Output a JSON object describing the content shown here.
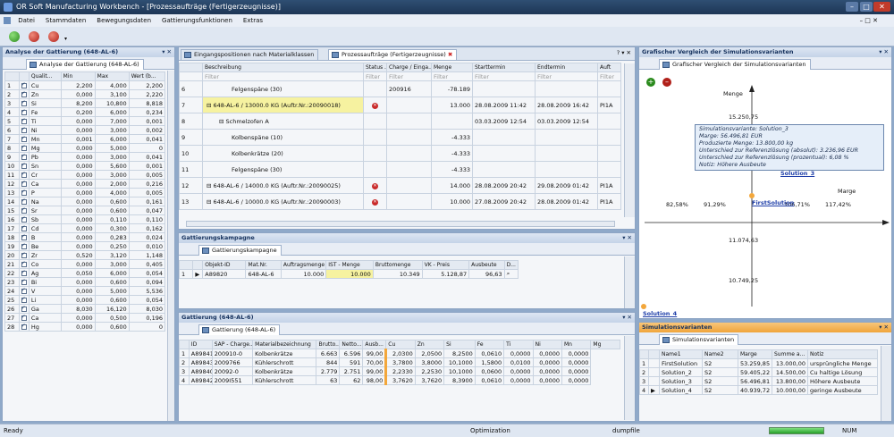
{
  "title": "OR Soft Manufacturing Workbench - [Prozessaufträge (Fertigerzeugnisse)]",
  "menu": [
    "Datei",
    "Stammdaten",
    "Bewegungsdaten",
    "Gattierungsfunktionen",
    "Extras"
  ],
  "left": {
    "title": "Analyse der Gattierung (648-AL-6)",
    "tab": "Analyse der Gattierung (648-AL-6)",
    "columns": [
      "A...",
      "Qualit...",
      "Min",
      "Max",
      "Wert (b..."
    ],
    "rows": [
      [
        "1",
        "Cu",
        "2,200",
        "4,000",
        "2,200"
      ],
      [
        "2",
        "Zn",
        "0,000",
        "3,100",
        "2,220"
      ],
      [
        "3",
        "Si",
        "8,200",
        "10,800",
        "8,818"
      ],
      [
        "4",
        "Fe",
        "0,200",
        "6,000",
        "0,234"
      ],
      [
        "5",
        "Ti",
        "0,000",
        "7,000",
        "0,001"
      ],
      [
        "6",
        "Ni",
        "0,000",
        "3,000",
        "0,002"
      ],
      [
        "7",
        "Mn",
        "0,001",
        "6,000",
        "0,041"
      ],
      [
        "8",
        "Mg",
        "0,000",
        "5,000",
        "0"
      ],
      [
        "9",
        "Pb",
        "0,000",
        "3,000",
        "0,041"
      ],
      [
        "10",
        "Sn",
        "0,000",
        "5,600",
        "0,001"
      ],
      [
        "11",
        "Cr",
        "0,000",
        "3,000",
        "0,005"
      ],
      [
        "12",
        "Ca",
        "0,000",
        "2,000",
        "0,216"
      ],
      [
        "13",
        "P",
        "0,000",
        "4,000",
        "0,005"
      ],
      [
        "14",
        "Na",
        "0,000",
        "0,600",
        "0,161"
      ],
      [
        "15",
        "Sr",
        "0,000",
        "0,600",
        "0,047"
      ],
      [
        "16",
        "Sb",
        "0,000",
        "0,110",
        "0,110"
      ],
      [
        "17",
        "Cd",
        "0,000",
        "0,300",
        "0,162"
      ],
      [
        "18",
        "B",
        "0,000",
        "0,283",
        "0,024"
      ],
      [
        "19",
        "Be",
        "0,000",
        "0,250",
        "0,010"
      ],
      [
        "20",
        "Zr",
        "0,520",
        "3,120",
        "1,148"
      ],
      [
        "21",
        "Co",
        "0,000",
        "3,000",
        "0,405"
      ],
      [
        "22",
        "Ag",
        "0,050",
        "6,000",
        "0,054"
      ],
      [
        "23",
        "Bi",
        "0,000",
        "0,600",
        "0,094"
      ],
      [
        "24",
        "V",
        "0,000",
        "5,000",
        "5,536"
      ],
      [
        "25",
        "Li",
        "0,000",
        "0,600",
        "0,054"
      ],
      [
        "26",
        "Ga",
        "8,030",
        "16,120",
        "8,030"
      ],
      [
        "27",
        "Ca",
        "0,000",
        "0,500",
        "0,196"
      ],
      [
        "28",
        "Hg",
        "0,000",
        "0,600",
        "0"
      ]
    ]
  },
  "center_top": {
    "tabs": [
      "Eingangspositionen nach Materialklassen",
      "Prozessaufträge (Fertigerzeugnisse)"
    ],
    "columns": [
      "Beschreibung",
      "Status ...",
      "Charge / Einga...",
      "Menge",
      "Starttermin",
      "Endtermin",
      "Auft"
    ],
    "filter": "Filter",
    "rows": [
      {
        "n": "6",
        "desc": "Felgenspäne (30)",
        "status": "",
        "charge": "200916",
        "menge": "-78.189",
        "start": "",
        "end": "",
        "auft": "",
        "indent": 2,
        "hl": false,
        "x": false
      },
      {
        "n": "7",
        "desc": "648-AL-6 / 13000.0 KG (Auftr.Nr.:20090018)",
        "status": "x",
        "charge": "",
        "menge": "13.000",
        "start": "28.08.2009 11:42",
        "end": "28.08.2009 16:42",
        "auft": "PI1A",
        "indent": 0,
        "hl": true,
        "x": true
      },
      {
        "n": "8",
        "desc": "Schmelzofen A",
        "status": "",
        "charge": "",
        "menge": "",
        "start": "03.03.2009 12:54",
        "end": "03.03.2009 12:54",
        "auft": "",
        "indent": 1,
        "hl": false,
        "x": false
      },
      {
        "n": "9",
        "desc": "Kolbenspäne (10)",
        "status": "",
        "charge": "",
        "menge": "-4.333",
        "start": "",
        "end": "",
        "auft": "",
        "indent": 2,
        "hl": false,
        "x": false
      },
      {
        "n": "10",
        "desc": "Kolbenkrätze (20)",
        "status": "",
        "charge": "",
        "menge": "-4.333",
        "start": "",
        "end": "",
        "auft": "",
        "indent": 2,
        "hl": false,
        "x": false
      },
      {
        "n": "11",
        "desc": "Felgenspäne (30)",
        "status": "",
        "charge": "",
        "menge": "-4.333",
        "start": "",
        "end": "",
        "auft": "",
        "indent": 2,
        "hl": false,
        "x": false
      },
      {
        "n": "12",
        "desc": "648-AL-6 / 14000.0 KG (Auftr.Nr.:20090025)",
        "status": "x",
        "charge": "",
        "menge": "14.000",
        "start": "28.08.2009 20:42",
        "end": "29.08.2009 01:42",
        "auft": "PI1A",
        "indent": 0,
        "hl": false,
        "x": true
      },
      {
        "n": "13",
        "desc": "648-AL-6 / 10000.0 KG (Auftr.Nr.:20090003)",
        "status": "x",
        "charge": "",
        "menge": "10.000",
        "start": "27.08.2009 20:42",
        "end": "28.08.2009 01:42",
        "auft": "PI1A",
        "indent": 0,
        "hl": false,
        "x": true
      }
    ]
  },
  "campaign": {
    "title": "Gattierungskampagne",
    "tab": "Gattierungskampagne",
    "columns": [
      "Objekt-ID",
      "Mat.Nr.",
      "Auftragsmenge",
      "IST - Menge",
      "Bruttomenge",
      "VK - Preis",
      "Ausbeute",
      "D..."
    ],
    "row": [
      "1",
      "A89820",
      "648-AL-6",
      "10.000",
      "10.000",
      "10.349",
      "5.128,87",
      "96,63"
    ]
  },
  "gatt": {
    "title": "Gattierung (648-AL-6)",
    "tab": "Gattierung (648-AL-6)",
    "columns": [
      "ID",
      "SAP - Charge...",
      "Materialbezeichnung",
      "Brutto...",
      "Netto...",
      "Ausb...",
      "Cu",
      "Zn",
      "Si",
      "Fe",
      "Ti",
      "Ni",
      "Mn",
      "Mg"
    ],
    "rows": [
      [
        "1",
        "A89841",
        "200910-0",
        "Kolbenkrätze",
        "6.663",
        "6.596",
        "99,00",
        "2,0300",
        "2,0500",
        "8,2500",
        "0,0610",
        "0,0000",
        "0,0000",
        "0,0000"
      ],
      [
        "2",
        "A89843",
        "2009766",
        "Kühlerschrott",
        "844",
        "591",
        "70,00",
        "3,7800",
        "3,8000",
        "10,1000",
        "1,5800",
        "0,0100",
        "0,0000",
        "0,0000"
      ],
      [
        "3",
        "A89840",
        "20092-0",
        "Kolbenkrätze",
        "2.779",
        "2.751",
        "99,00",
        "2,2330",
        "2,2530",
        "10,1000",
        "0,0600",
        "0,0000",
        "0,0000",
        "0,0000"
      ],
      [
        "4",
        "A89842",
        "2009I551",
        "Kühlerschrott",
        "63",
        "62",
        "98,00",
        "3,7620",
        "3,7620",
        "8,3900",
        "0,0610",
        "0,0000",
        "0,0000",
        "0,0000"
      ]
    ]
  },
  "chart": {
    "panel_title": "Grafischer Vergleich der Simulationsvarianten",
    "tab": "Grafischer Vergleich der Simulationsvarianten",
    "ylabel": "Menge",
    "xlabel": "Marge",
    "yticks": [
      "15.250,75",
      "11.074,63",
      "10.749,25"
    ],
    "xticks": [
      "82,58%",
      "91,29%",
      "106,71%",
      "117,42%"
    ],
    "points": [
      "Solution_3",
      "FirstSolution",
      "Solution_4"
    ],
    "tooltip": [
      "Simulationsvariante: Solution_3",
      "Marge: 56.496,81 EUR",
      "Produzierte Menge: 13.800,00 kg",
      "Unterschied zur Referenzlösung (absolut): 3.236,96 EUR",
      "Unterschied zur Referenzlösung (prozentual): 6,08 %",
      "Notiz: Höhere Ausbeute"
    ]
  },
  "sim": {
    "title": "Simulationsvarianten",
    "tab": "Simulationsvarianten",
    "columns": [
      "Name1",
      "Name2",
      "Marge",
      "Summe a...",
      "Notiz"
    ],
    "rows": [
      [
        "1",
        "FirstSolution",
        "S2",
        "53.259,85",
        "13.000,00",
        "ursprüngliche Menge"
      ],
      [
        "2",
        "Solution_2",
        "S2",
        "59.405,22",
        "14.500,00",
        "Cu haltige Lösung"
      ],
      [
        "3",
        "Solution_3",
        "S2",
        "56.496,81",
        "13.800,00",
        "Höhere Ausbeute"
      ],
      [
        "4",
        "Solution_4",
        "S2",
        "40.939,72",
        "10.000,00",
        "geringe Ausbeute"
      ]
    ]
  },
  "status": {
    "left": "Ready",
    "opt": "Optimization",
    "file": "dumpfile",
    "num": "NUM"
  }
}
